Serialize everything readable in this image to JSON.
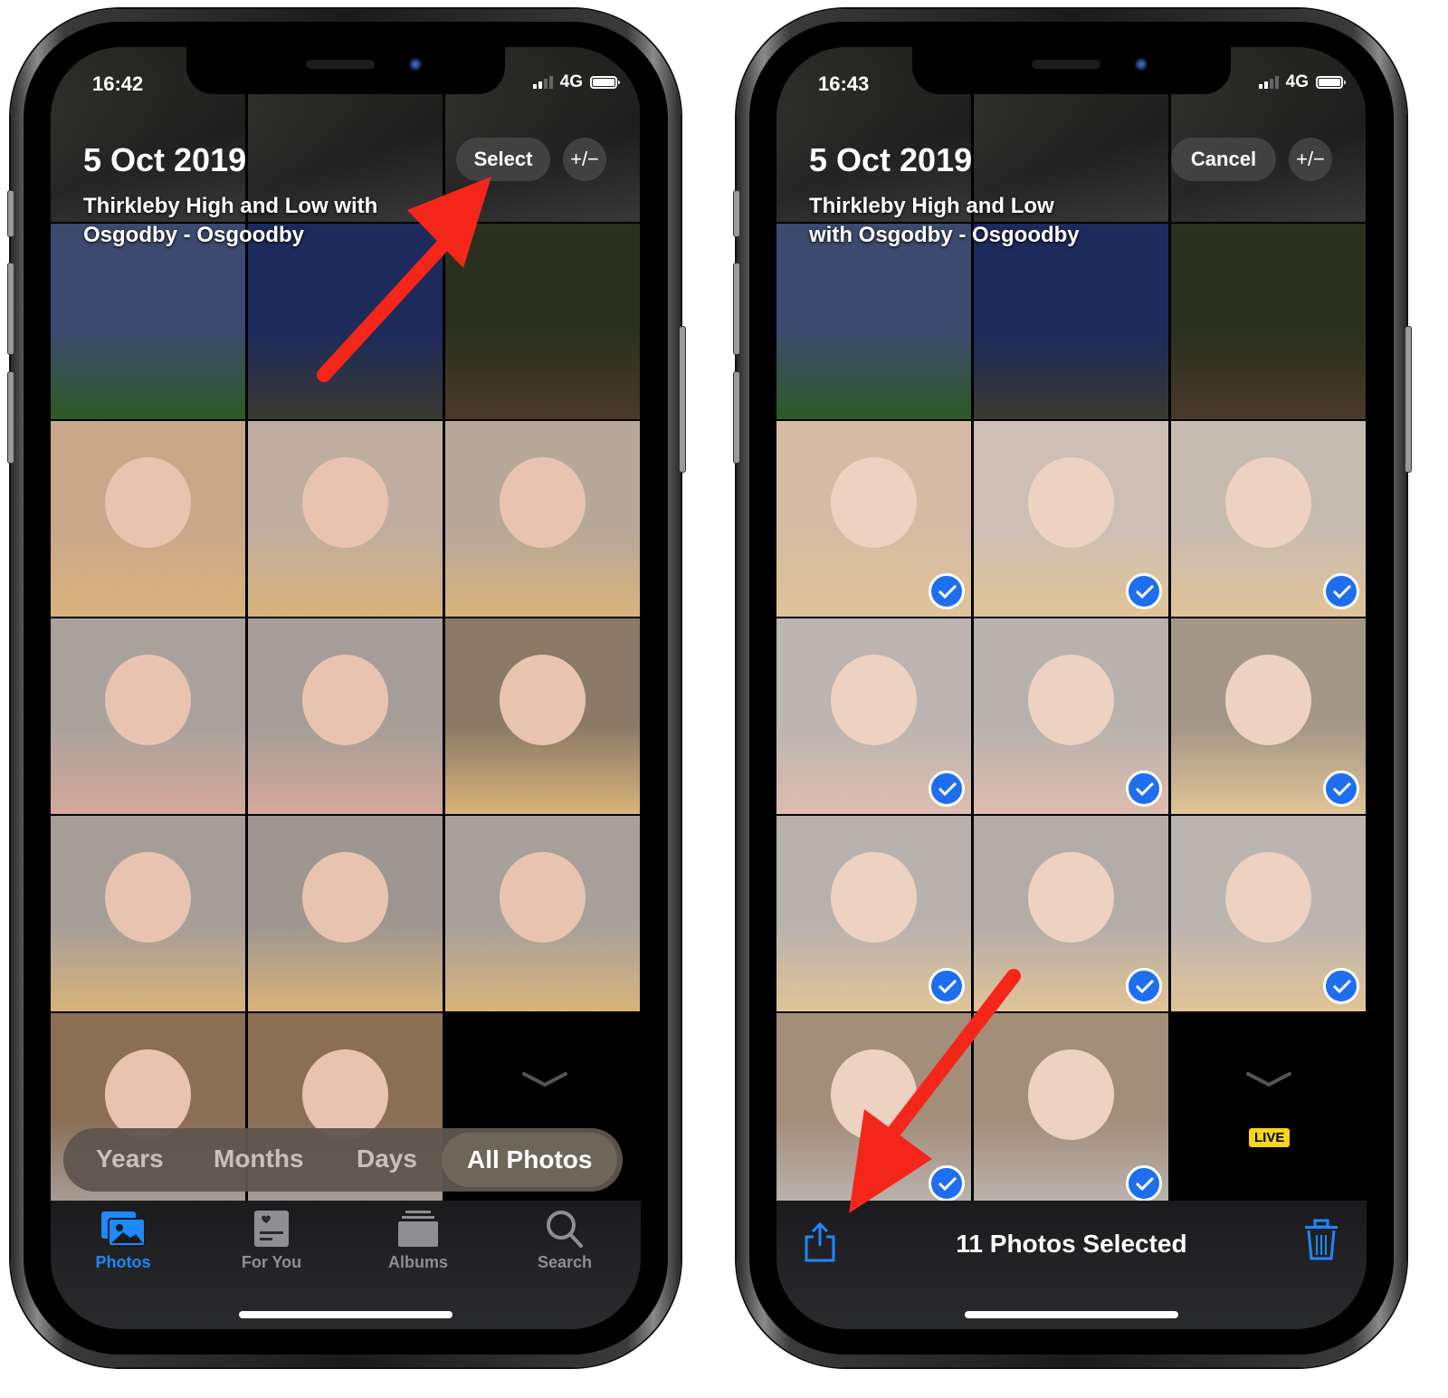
{
  "left_phone": {
    "status": {
      "time": "16:42",
      "network": "4G"
    },
    "header": {
      "date": "5 Oct 2019",
      "location_line1": "Thirkleby High and Low with",
      "location_line2": "Osgodby - Osgoodby",
      "select_label": "Select",
      "plusminus_label": "+/−"
    },
    "segmented": {
      "items": [
        "Years",
        "Months",
        "Days",
        "All Photos"
      ],
      "selected": "All Photos"
    },
    "tabs": [
      {
        "label": "Photos",
        "icon": "photos-icon",
        "active": true
      },
      {
        "label": "For You",
        "icon": "for-you-icon",
        "active": false
      },
      {
        "label": "Albums",
        "icon": "albums-icon",
        "active": false
      },
      {
        "label": "Search",
        "icon": "search-icon",
        "active": false
      }
    ],
    "annotation": "red arrow pointing to Select"
  },
  "right_phone": {
    "status": {
      "time": "16:43",
      "network": "4G"
    },
    "header": {
      "date": "5 Oct 2019",
      "location_line1": "Thirkleby High and Low",
      "location_line2": "with Osgodby - Osgoodby",
      "cancel_label": "Cancel",
      "plusminus_label": "+/−"
    },
    "live_badge": "LIVE",
    "selection_bar": {
      "count_text": "11 Photos Selected",
      "share_icon": "share-icon",
      "trash_icon": "trash-icon"
    },
    "selected_count": 11,
    "annotation": "red arrow pointing to share button"
  },
  "colors": {
    "accent": "#1e88ff",
    "check": "#1e6ff0",
    "live": "#f6d41a",
    "arrow": "#f4261a"
  },
  "photos": [
    {
      "scene": "night-field",
      "c1": "#3b4a6e",
      "c2": "#2d5a22"
    },
    {
      "scene": "woman-baby-blue",
      "c1": "#1d2a5c",
      "c2": "#3a3a30"
    },
    {
      "scene": "woman-baby-night",
      "c1": "#2a3020",
      "c2": "#4a3a2a"
    },
    {
      "scene": "baby-feeding",
      "c1": "#c9a88a",
      "c2": "#d9b37a"
    },
    {
      "scene": "baby-highchair",
      "c1": "#bfaea0",
      "c2": "#d9b37a"
    },
    {
      "scene": "baby-highchair",
      "c1": "#b7a89a",
      "c2": "#d9b37a"
    },
    {
      "scene": "baby-closeup",
      "c1": "#a9a19c",
      "c2": "#d6a999"
    },
    {
      "scene": "baby-closeup",
      "c1": "#a59d98",
      "c2": "#d6a999"
    },
    {
      "scene": "baby-table",
      "c1": "#8a7a66",
      "c2": "#d9b37a"
    },
    {
      "scene": "baby-bowl",
      "c1": "#a59d98",
      "c2": "#d9b37a"
    },
    {
      "scene": "baby-cup",
      "c1": "#9e9690",
      "c2": "#d9b37a"
    },
    {
      "scene": "baby-cup",
      "c1": "#a8a09a",
      "c2": "#d9b37a"
    },
    {
      "scene": "baby-highchair-bottom",
      "c1": "#8a6f55",
      "c2": "#a9a19c"
    },
    {
      "scene": "baby-cup-bottom",
      "c1": "#8a6f55",
      "c2": "#a9a19c"
    }
  ]
}
